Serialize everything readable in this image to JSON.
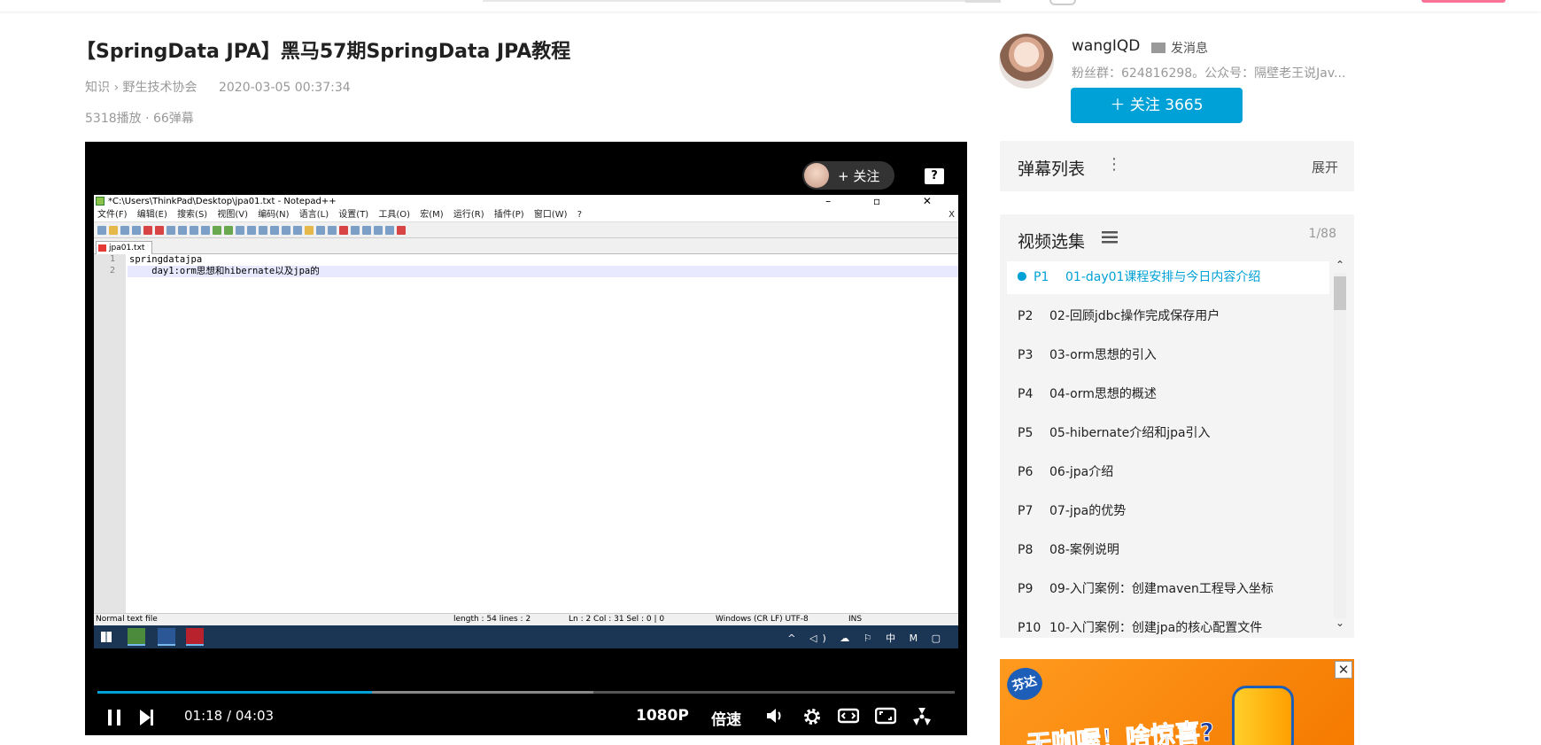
{
  "video": {
    "title": "【SpringData JPA】黑马57期SpringData JPA教程",
    "breadcrumb_parent": "知识",
    "breadcrumb_sep": "›",
    "breadcrumb_child": "野生技术协会",
    "date": "2020-03-05 00:37:34",
    "stats": "5318播放 · 66弹幕"
  },
  "player": {
    "follow_pill": "+ 关注",
    "help_icon": "?",
    "current_time": "01:18",
    "time_sep": "/",
    "duration": "04:03",
    "progress_fraction": 0.32,
    "quality": "1080P",
    "speed": "倍速",
    "icons": {
      "pause": "pause-icon",
      "next": "next-icon",
      "volume": "volume-icon",
      "settings": "gear-icon",
      "widescreen": "widescreen-icon",
      "webfullscreen": "web-fullscreen-icon",
      "fullscreen": "fullscreen-icon"
    }
  },
  "notepad": {
    "title": "*C:\\Users\\ThinkPad\\Desktop\\jpa01.txt - Notepad++",
    "win_buttons": "–  ▫  ✕",
    "menus": [
      "文件(F)",
      "编辑(E)",
      "搜索(S)",
      "视图(V)",
      "编码(N)",
      "语言(L)",
      "设置(T)",
      "工具(O)",
      "宏(M)",
      "运行(R)",
      "插件(P)",
      "窗口(W)",
      "?"
    ],
    "menu_close": "X",
    "tab": "jpa01.txt",
    "lines": [
      "springdatajpa",
      "    day1:orm思想和hibernate以及jpa的"
    ],
    "line_numbers": [
      "1",
      "2"
    ],
    "status": {
      "type": "Normal text file",
      "length": "length : 54    lines : 2",
      "pos": "Ln : 2    Col : 31    Sel : 0 | 0",
      "eol": "Windows (CR LF)  UTF-8",
      "mode": "INS"
    },
    "tray": "^ ◁) ☁ ⚐ 中 M ▢"
  },
  "uploader": {
    "name": "wangIQD",
    "message": "发消息",
    "desc": "粉丝群：624816298。公众号：隔壁老王说Jav...",
    "follow": "＋  关注 3665"
  },
  "danmaku": {
    "title": "弹幕列表",
    "more": "⋮",
    "expand": "展开"
  },
  "episodes": {
    "title": "视频选集",
    "count": "1/88",
    "items": [
      {
        "p": "P1",
        "name": "01-day01课程安排与今日内容介绍"
      },
      {
        "p": "P2",
        "name": "02-回顾jdbc操作完成保存用户"
      },
      {
        "p": "P3",
        "name": "03-orm思想的引入"
      },
      {
        "p": "P4",
        "name": "04-orm思想的概述"
      },
      {
        "p": "P5",
        "name": "05-hibernate介绍和jpa引入"
      },
      {
        "p": "P6",
        "name": "06-jpa介绍"
      },
      {
        "p": "P7",
        "name": "07-jpa的优势"
      },
      {
        "p": "P8",
        "name": "08-案例说明"
      },
      {
        "p": "P9",
        "name": "09-入门案例：创建maven工程导入坐标"
      },
      {
        "p": "P10",
        "name": "10-入门案例：创建jpa的核心配置文件"
      }
    ]
  },
  "ad": {
    "logo": "芬达",
    "slogan": "无咖喔！啥惊喜?",
    "close": "✕"
  },
  "colors": {
    "accent": "#00a1d6",
    "panel_bg": "#f4f4f4",
    "player_bg": "#000000"
  }
}
